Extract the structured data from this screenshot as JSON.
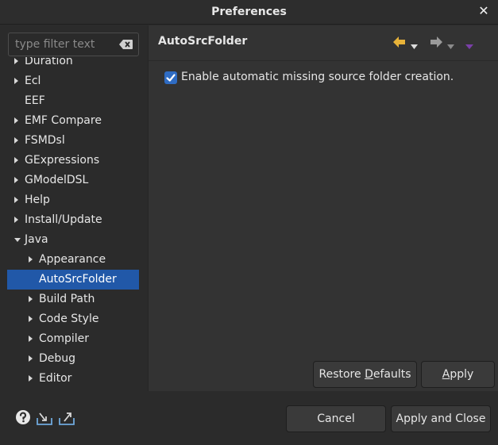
{
  "window": {
    "title": "Preferences",
    "close_glyph": "✕"
  },
  "filter": {
    "placeholder": "type filter text",
    "clear_icon": "clear-filter-icon"
  },
  "tree": {
    "items": [
      {
        "label": "Duration",
        "level": 0,
        "expandable": true,
        "expanded": false,
        "selected": false
      },
      {
        "label": "Ecl",
        "level": 0,
        "expandable": true,
        "expanded": false,
        "selected": false
      },
      {
        "label": "EEF",
        "level": 0,
        "expandable": false,
        "expanded": false,
        "selected": false
      },
      {
        "label": "EMF Compare",
        "level": 0,
        "expandable": true,
        "expanded": false,
        "selected": false
      },
      {
        "label": "FSMDsl",
        "level": 0,
        "expandable": true,
        "expanded": false,
        "selected": false
      },
      {
        "label": "GExpressions",
        "level": 0,
        "expandable": true,
        "expanded": false,
        "selected": false
      },
      {
        "label": "GModelDSL",
        "level": 0,
        "expandable": true,
        "expanded": false,
        "selected": false
      },
      {
        "label": "Help",
        "level": 0,
        "expandable": true,
        "expanded": false,
        "selected": false
      },
      {
        "label": "Install/Update",
        "level": 0,
        "expandable": true,
        "expanded": false,
        "selected": false
      },
      {
        "label": "Java",
        "level": 0,
        "expandable": true,
        "expanded": true,
        "selected": false
      },
      {
        "label": "Appearance",
        "level": 1,
        "expandable": true,
        "expanded": false,
        "selected": false
      },
      {
        "label": "AutoSrcFolder",
        "level": 1,
        "expandable": false,
        "expanded": false,
        "selected": true
      },
      {
        "label": "Build Path",
        "level": 1,
        "expandable": true,
        "expanded": false,
        "selected": false
      },
      {
        "label": "Code Style",
        "level": 1,
        "expandable": true,
        "expanded": false,
        "selected": false
      },
      {
        "label": "Compiler",
        "level": 1,
        "expandable": true,
        "expanded": false,
        "selected": false
      },
      {
        "label": "Debug",
        "level": 1,
        "expandable": true,
        "expanded": false,
        "selected": false
      },
      {
        "label": "Editor",
        "level": 1,
        "expandable": true,
        "expanded": false,
        "selected": false
      }
    ]
  },
  "page": {
    "title": "AutoSrcFolder",
    "option_label": "Enable automatic missing source folder creation.",
    "option_checked": true
  },
  "nav": {
    "back_icon": "back-arrow-icon",
    "forward_icon": "forward-arrow-icon",
    "menu_icon": "view-menu-icon"
  },
  "buttons": {
    "restore_defaults_pre": "Restore ",
    "restore_defaults_mnemonic": "D",
    "restore_defaults_post": "efaults",
    "apply_mnemonic": "A",
    "apply_post": "pply",
    "cancel": "Cancel",
    "apply_and_close": "Apply and Close"
  },
  "footer": {
    "help_icon": "help-icon",
    "import_icon": "import-icon",
    "export_icon": "export-icon"
  },
  "colors": {
    "selection": "#2158a8",
    "checkbox": "#2f6cc3",
    "back_arrow": "#e8b339",
    "menu_arrow": "#7a3fa8"
  }
}
